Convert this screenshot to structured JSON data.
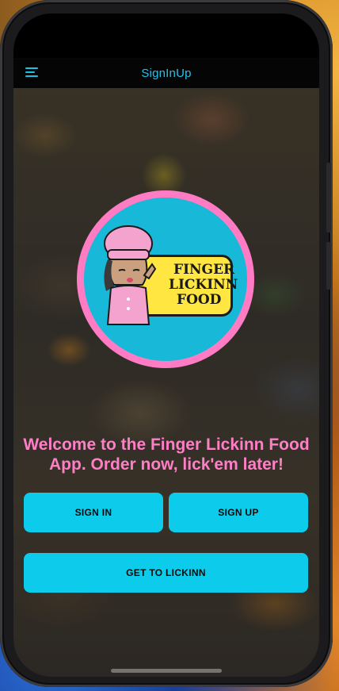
{
  "appbar": {
    "title": "SignInUp",
    "menu_icon": "hamburger-menu-icon"
  },
  "logo": {
    "line1": "FINGER",
    "line2": "LICKINN",
    "line3": "FOOD",
    "ring_color": "#ff7cc4",
    "bg_color": "#18b8d8"
  },
  "welcome_text": "Welcome to the Finger Lickinn Food App. Order now, lick'em later!",
  "buttons": {
    "sign_in": "SIGN IN",
    "sign_up": "SIGN UP",
    "get_to_lickinn": "GET TO LICKINN"
  },
  "colors": {
    "accent": "#0ccbeb",
    "title": "#25c3ec",
    "welcome": "#ff7fc6"
  }
}
